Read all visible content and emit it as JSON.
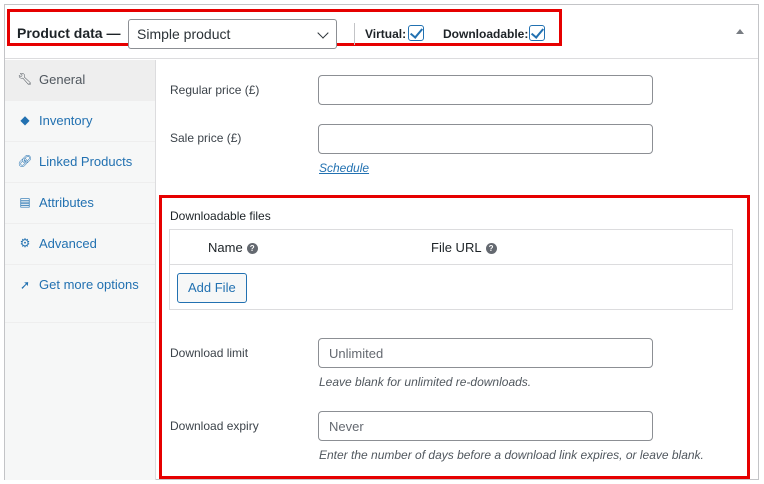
{
  "header": {
    "title": "Product data —",
    "product_type": "Simple product",
    "virtual_label": "Virtual:",
    "virtual_checked": true,
    "downloadable_label": "Downloadable:",
    "downloadable_checked": true
  },
  "sidebar": {
    "items": [
      {
        "label": "General",
        "icon": "wrench-icon"
      },
      {
        "label": "Inventory",
        "icon": "tag-icon"
      },
      {
        "label": "Linked Products",
        "icon": "link-icon"
      },
      {
        "label": "Attributes",
        "icon": "list-icon"
      },
      {
        "label": "Advanced",
        "icon": "gear-icon"
      },
      {
        "label": "Get more options",
        "icon": "plugin-icon"
      }
    ]
  },
  "general": {
    "regular_price_label": "Regular price (£)",
    "regular_price_value": "",
    "sale_price_label": "Sale price (£)",
    "sale_price_value": "",
    "schedule_link": "Schedule"
  },
  "downloads": {
    "section_label": "Downloadable files",
    "columns": [
      "Name",
      "File URL"
    ],
    "add_file_label": "Add File",
    "limit_label": "Download limit",
    "limit_placeholder": "Unlimited",
    "limit_hint": "Leave blank for unlimited re-downloads.",
    "expiry_label": "Download expiry",
    "expiry_placeholder": "Never",
    "expiry_hint": "Enter the number of days before a download link expires, or leave blank."
  },
  "colors": {
    "accent": "#2271b1",
    "highlight": "#e60000"
  }
}
